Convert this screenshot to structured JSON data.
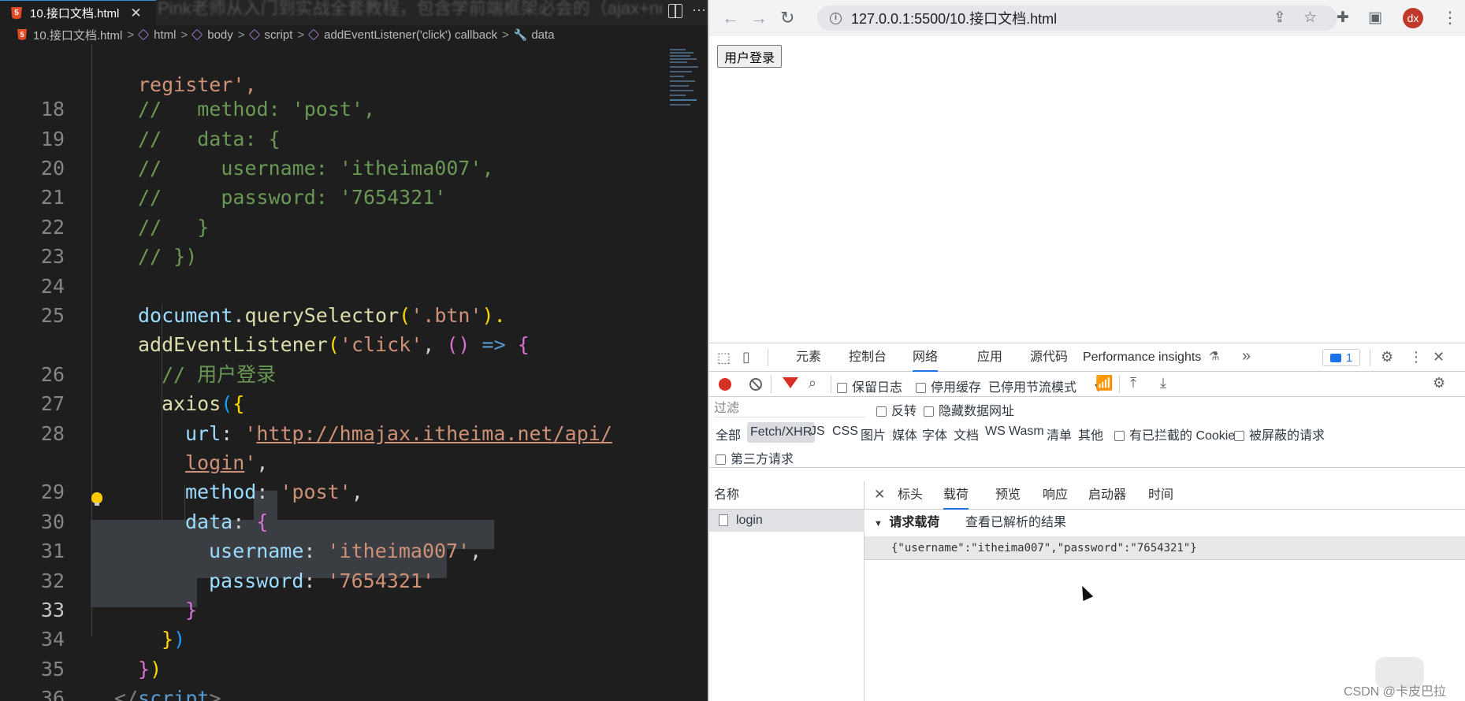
{
  "editor": {
    "tab": {
      "title": "10.接口文档.html",
      "close": "✕"
    },
    "more": "···",
    "blurred_banner": "Pink老师从入门到实战全套教程，包含学前端框架必会的（ajax+node）",
    "breadcrumb": {
      "file": "10.接口文档.html",
      "html": "html",
      "body": "body",
      "script": "script",
      "callback": "addEventListener('click') callback",
      "data": "data",
      "sep": ">"
    },
    "line_numbers": [
      "18",
      "19",
      "20",
      "21",
      "22",
      "23",
      "24",
      "25",
      "26",
      "27",
      "28",
      "29",
      "30",
      "31",
      "32",
      "33",
      "34",
      "35",
      "36"
    ],
    "active_line": "33",
    "code": {
      "l0": "register',",
      "l18_c": "//   method: 'post',",
      "l19_c": "//   data: {",
      "l20_c": "//     username: 'itheima007',",
      "l21_c": "//     password: '7654321'",
      "l22_c": "//   }",
      "l23_c": "// })",
      "l25_a": "document",
      "l25_b": ".",
      "l25_c": "querySelector",
      "l25_d": "(",
      "l25_e": "'.btn'",
      "l25_f": ").",
      "l25w_a": "addEventListener",
      "l25w_b": "(",
      "l25w_c": "'click'",
      "l25w_d": ", ",
      "l25w_e": "()",
      "l25w_f": " => ",
      "l25w_g": "{",
      "l26_c": "// 用户登录",
      "l27_a": "axios",
      "l27_b": "(",
      "l27_c": "{",
      "l28_a": "url",
      "l28_b": ": ",
      "l28_c": "'",
      "l28_d": "http://hmajax.itheima.net/api/",
      "l28w_a": "login",
      "l28w_b": "'",
      "l28w_c": ",",
      "l29_a": "method",
      "l29_b": ": ",
      "l29_c": "'post'",
      "l29_d": ",",
      "l30_a": "data",
      "l30_b": ": ",
      "l30_c": "{",
      "l31_a": "username",
      "l31_b": ": ",
      "l31_c": "'itheima007'",
      "l31_d": ",",
      "l32_a": "password",
      "l32_b": ": ",
      "l32_c": "'7654321'",
      "l33_a": "}",
      "l34_a": "}",
      "l34_b": ")",
      "l35_a": "}",
      "l35_b": ")",
      "l36_a": "</",
      "l36_b": "script",
      "l36_c": ">"
    }
  },
  "browser": {
    "url": "127.0.0.1:5500/10.接口文档.html",
    "avatar": "dx",
    "page": {
      "login_button": "用户登录"
    },
    "devtools": {
      "tabs": [
        "元素",
        "控制台",
        "网络",
        "应用",
        "源代码",
        "Performance insights"
      ],
      "active_tab": "网络",
      "more_tabs": "»",
      "issues_count": "1",
      "preserve_log": "保留日志",
      "disable_cache": "停用缓存",
      "throttling": "已停用节流模式",
      "filter_placeholder": "过滤",
      "invert": "反转",
      "hide_data_urls": "隐藏数据网址",
      "types": [
        "全部",
        "Fetch/XHR",
        "JS",
        "CSS",
        "图片",
        "媒体",
        "字体",
        "文档",
        "WS",
        "Wasm",
        "清单",
        "其他"
      ],
      "selected_type": "Fetch/XHR",
      "blocked_cookies": "有已拦截的 Cookie",
      "blocked_requests": "被屏蔽的请求",
      "third_party": "第三方请求",
      "name_header": "名称",
      "request_name": "login",
      "detail_tabs": [
        "标头",
        "载荷",
        "预览",
        "响应",
        "启动器",
        "时间"
      ],
      "active_detail_tab": "载荷",
      "close": "✕",
      "payload_title": "请求载荷",
      "parsed_link": "查看已解析的结果",
      "payload_body": "{\"username\":\"itheima007\",\"password\":\"7654321\"}"
    }
  },
  "watermark": "CSDN @卡皮巴拉",
  "colors": {
    "accent": "#1a73e8",
    "record": "#d93025",
    "comment": "#6a9955",
    "string": "#ce9178"
  }
}
